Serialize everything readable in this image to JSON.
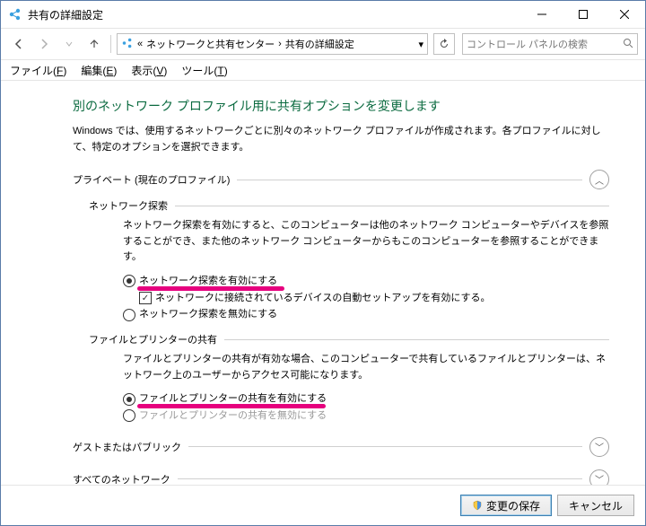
{
  "window": {
    "title": "共有の詳細設定"
  },
  "breadcrumb": {
    "root": "«",
    "item1": "ネットワークと共有センター",
    "item2": "共有の詳細設定"
  },
  "search": {
    "placeholder": "コントロール パネルの検索"
  },
  "menu": {
    "file": "ファイル(F)",
    "edit": "編集(E)",
    "view": "表示(V)",
    "tool": "ツール(T)"
  },
  "heading": "別のネットワーク プロファイル用に共有オプションを変更します",
  "description": "Windows では、使用するネットワークごとに別々のネットワーク プロファイルが作成されます。各プロファイルに対して、特定のオプションを選択できます。",
  "sections": {
    "private": {
      "label": "プライベート (現在のプロファイル)",
      "network_discovery": {
        "title": "ネットワーク探索",
        "desc": "ネットワーク探索を有効にすると、このコンピューターは他のネットワーク コンピューターやデバイスを参照することができ、また他のネットワーク コンピューターからもこのコンピューターを参照することができます。",
        "opt_on": "ネットワーク探索を有効にする",
        "opt_auto": "ネットワークに接続されているデバイスの自動セットアップを有効にする。",
        "opt_off": "ネットワーク探索を無効にする"
      },
      "file_printer": {
        "title": "ファイルとプリンターの共有",
        "desc": "ファイルとプリンターの共有が有効な場合、このコンピューターで共有しているファイルとプリンターは、ネットワーク上のユーザーからアクセス可能になります。",
        "opt_on": "ファイルとプリンターの共有を有効にする",
        "opt_off": "ファイルとプリンターの共有を無効にする"
      }
    },
    "guest": {
      "label": "ゲストまたはパブリック"
    },
    "all": {
      "label": "すべてのネットワーク"
    }
  },
  "footer": {
    "save": "変更の保存",
    "cancel": "キャンセル"
  },
  "icons": {
    "chev_up": "︿",
    "chev_down": "﹀",
    "check": "✓",
    "dropdown": "▾",
    "arrow_right": "›"
  }
}
